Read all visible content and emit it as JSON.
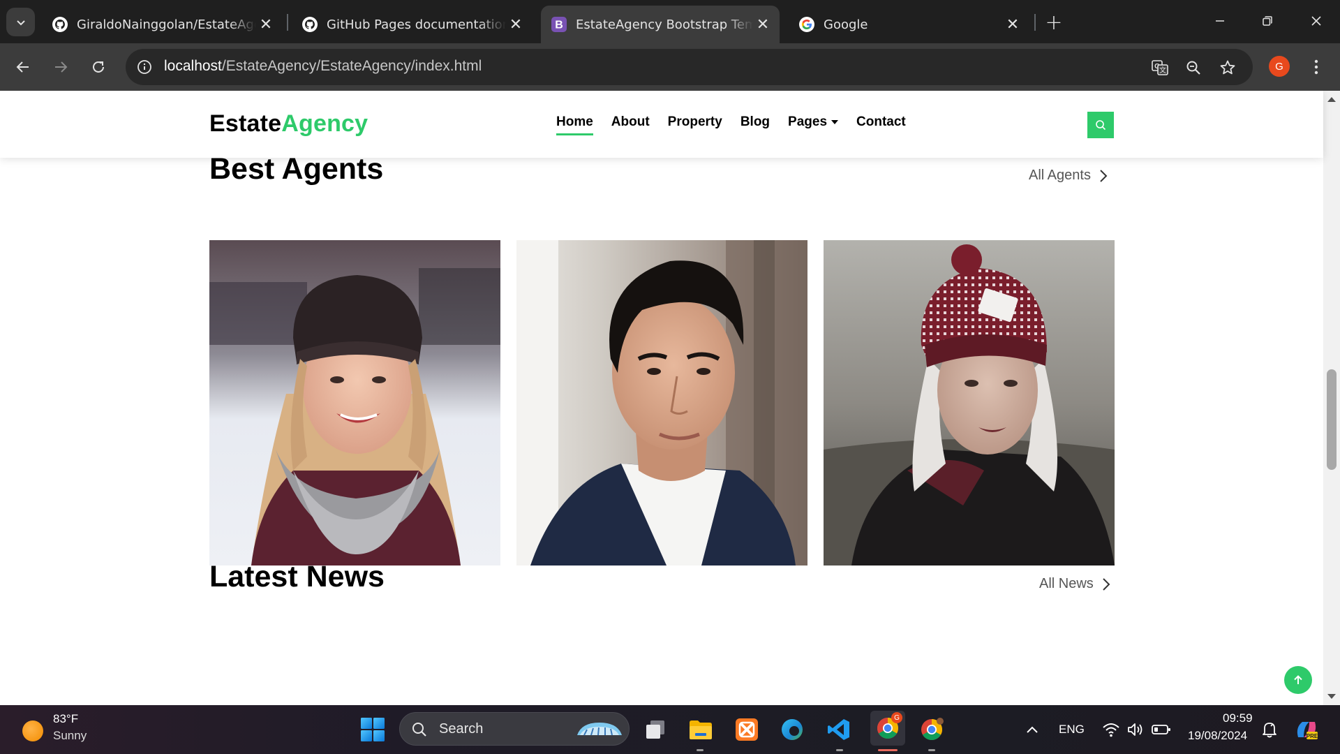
{
  "browser": {
    "tabs": [
      {
        "title": "GiraldoNainggolan/EstateAgency",
        "favicon": "github-icon",
        "active": false
      },
      {
        "title": "GitHub Pages documentation - GitHub Docs",
        "favicon": "github-icon",
        "active": false
      },
      {
        "title": "EstateAgency Bootstrap Template",
        "favicon": "bootstrap-icon",
        "active": true
      },
      {
        "title": "Google",
        "favicon": "google-icon",
        "active": false
      }
    ],
    "url": {
      "host": "localhost",
      "path": "/EstateAgency/EstateAgency/index.html"
    },
    "profile_initial": "G"
  },
  "site": {
    "logo": {
      "part1": "Estate",
      "part2": "Agency"
    },
    "menu": [
      {
        "label": "Home",
        "active": true
      },
      {
        "label": "About",
        "active": false
      },
      {
        "label": "Property",
        "active": false
      },
      {
        "label": "Blog",
        "active": false
      },
      {
        "label": "Pages",
        "active": false,
        "dropdown": true
      },
      {
        "label": "Contact",
        "active": false
      }
    ],
    "accent_color": "#2eca6a",
    "agents_section": {
      "title": "Best Agents",
      "link": "All Agents"
    },
    "news_section": {
      "title": "Latest News",
      "link": "All News"
    },
    "agents": [
      {
        "photo": "agent-photo-woman-black-beanie"
      },
      {
        "photo": "agent-photo-man-suit"
      },
      {
        "photo": "agent-photo-woman-red-beanie"
      }
    ]
  },
  "taskbar": {
    "weather": {
      "temp": "83°F",
      "condition": "Sunny"
    },
    "search_placeholder": "Search",
    "language": "ENG",
    "time": "09:59",
    "date": "19/08/2024"
  }
}
